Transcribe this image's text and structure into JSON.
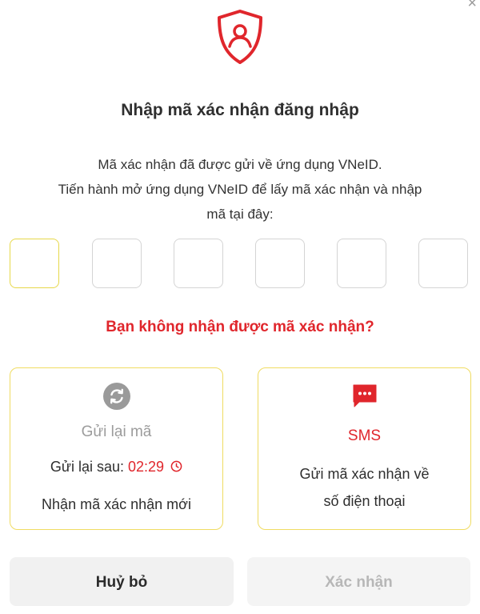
{
  "dialog": {
    "close_glyph": "×",
    "title": "Nhập mã xác nhận đăng nhập",
    "description": {
      "line1": "Mã xác nhận đã được gửi về ứng dụng VNeID.",
      "line2": "Tiến hành mở ứng dụng VNeID để lấy mã xác nhận và nhập",
      "line3": "mã tại đây:"
    },
    "otp": {
      "digits": [
        "",
        "",
        "",
        "",
        "",
        ""
      ],
      "active_index": 0
    },
    "not_received": "Bạn không nhận được mã xác nhận?"
  },
  "resend_card": {
    "icon": "refresh-icon",
    "label": "Gửi lại mã",
    "countdown_prefix": "Gửi lại sau:",
    "countdown_time": "02:29",
    "countdown_icon": "clock-icon",
    "new_code_text": "Nhận mã xác nhận mới"
  },
  "sms_card": {
    "icon": "message-icon",
    "label": "SMS",
    "desc_line1": "Gửi mã xác nhận về",
    "desc_line2": "số điện thoại"
  },
  "actions": {
    "cancel_label": "Huỷ bỏ",
    "confirm_label": "Xác nhận",
    "confirm_enabled": false
  },
  "colors": {
    "accent_red": "#e0262c",
    "highlight_yellow": "#f0dc62",
    "disabled_text": "#b7b7b7"
  }
}
